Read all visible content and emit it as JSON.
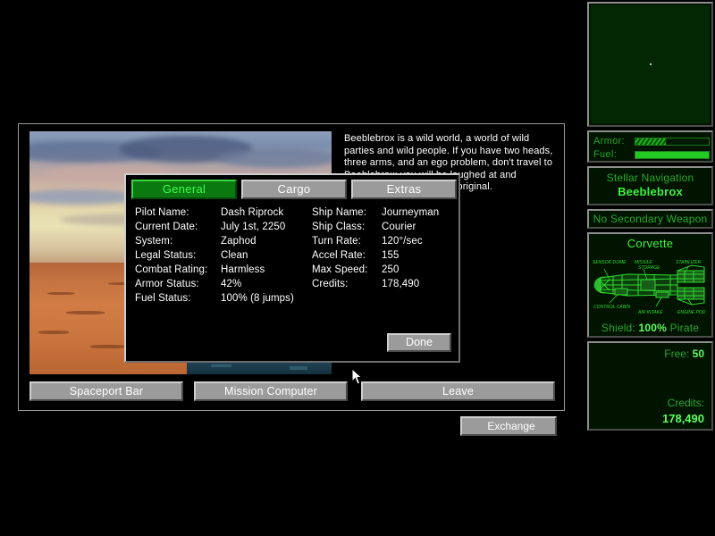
{
  "planet": {
    "description": "Beeblebrox is a wild world, a world of wild parties and wild people. If you have two heads, three arms, and an ego problem, don't travel to Beeblebrox; you will be laughed at and considered boring and unoriginal."
  },
  "main_buttons": {
    "exchange": "Exchange",
    "spaceport_bar": "Spaceport Bar",
    "mission_computer": "Mission Computer",
    "leave": "Leave"
  },
  "dialog": {
    "tabs": [
      {
        "label": "General",
        "active": true
      },
      {
        "label": "Cargo",
        "active": false
      },
      {
        "label": "Extras",
        "active": false
      }
    ],
    "done_label": "Done",
    "stats_left": [
      {
        "label": "Pilot Name:",
        "value": "Dash Riprock"
      },
      {
        "label": "Current Date:",
        "value": "July 1st, 2250"
      },
      {
        "label": "System:",
        "value": "Zaphod"
      },
      {
        "label": "Legal Status:",
        "value": "Clean"
      },
      {
        "label": "Combat Rating:",
        "value": "Harmless"
      },
      {
        "label": "Armor Status:",
        "value": "42%"
      },
      {
        "label": "Fuel Status:",
        "value": "100%  (8 jumps)"
      }
    ],
    "stats_right": [
      {
        "label": "Ship Name:",
        "value": "Journeyman"
      },
      {
        "label": "Ship Class:",
        "value": "Courier"
      },
      {
        "label": "Turn Rate:",
        "value": "120°/sec"
      },
      {
        "label": "Accel Rate:",
        "value": "155"
      },
      {
        "label": "Max Speed:",
        "value": "250"
      },
      {
        "label": "Credits:",
        "value": "178,490"
      }
    ]
  },
  "hud": {
    "gauges": {
      "armor_label": "Armor:",
      "armor_percent": 42,
      "fuel_label": "Fuel:",
      "fuel_percent": 100
    },
    "navigation": {
      "title": "Stellar Navigation",
      "destination": "Beeblebrox"
    },
    "secondary_weapon": "No Secondary Weapon",
    "ship": {
      "title": "Corvette",
      "shield_label": "Shield:",
      "shield_value": "100%",
      "faction": "Pirate",
      "part_labels": [
        "SENSOR DOME",
        "MISSILE STORAGE",
        "STABILIZER",
        "CONTROL CABIN",
        "AIR INTAKE",
        "ENGINE POD"
      ]
    },
    "cargo": {
      "free_label": "Free:",
      "free_value": "50",
      "credits_label": "Credits:",
      "credits_value": "178,490"
    }
  },
  "colors": {
    "hud_green": "#2aa82a",
    "hud_bright_green": "#3ff23f",
    "panel_gray": "#9b9b9b",
    "background": "#000000"
  }
}
